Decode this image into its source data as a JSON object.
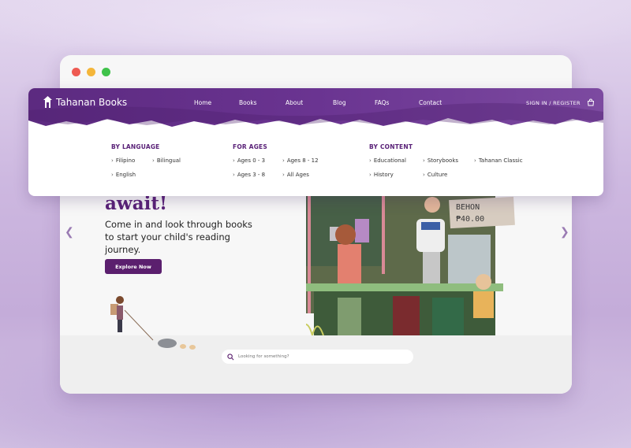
{
  "window": {
    "controls": [
      "close",
      "minimize",
      "maximize"
    ]
  },
  "nav": {
    "brand": "Tahanan Books",
    "links": [
      "Home",
      "Books",
      "About",
      "Blog",
      "FAQs",
      "Contact"
    ],
    "signin": "SIGN IN / REGISTER",
    "brand_color": "#5b2478"
  },
  "mega_menu": {
    "columns": [
      {
        "heading": "BY LANGUAGE",
        "items": [
          "Filipino",
          "Bilingual",
          "English"
        ]
      },
      {
        "heading": "FOR AGES",
        "items": [
          "Ages 0 - 3",
          "Ages 8 - 12",
          "Ages 3 - 8",
          "All Ages"
        ]
      },
      {
        "heading": "BY CONTENT",
        "items": [
          "Educational",
          "Storybooks",
          "Tahanan Classic",
          "History",
          "Culture"
        ]
      }
    ]
  },
  "hero": {
    "title": "await!",
    "subtitle": "Come in and look through books to start your child's reading journey.",
    "cta": "Explore Now",
    "sign_line1": "BEHON",
    "sign_line2": "₱40.00"
  },
  "search": {
    "placeholder": "Looking for something?"
  },
  "colors": {
    "accent": "#5b1f6e",
    "heading": "#5a2278",
    "background": "#cdb8e0"
  }
}
